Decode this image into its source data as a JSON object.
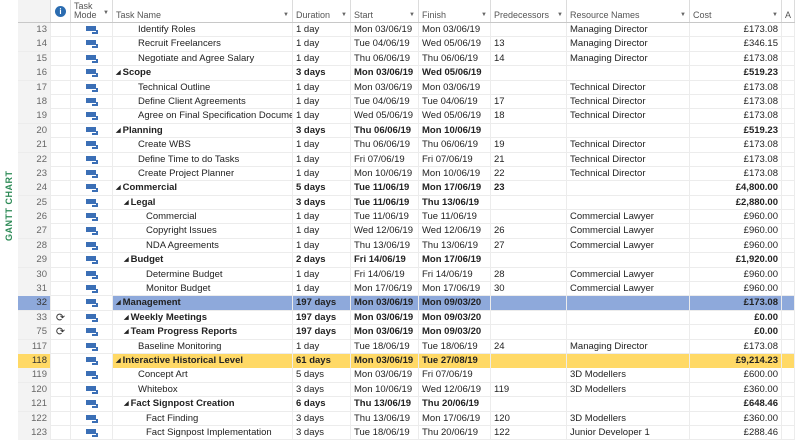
{
  "side_label": "GANTT CHART",
  "columns": {
    "indicators": "i",
    "mode": "Task Mode",
    "name": "Task Name",
    "duration": "Duration",
    "start": "Start",
    "finish": "Finish",
    "predecessors": "Predecessors",
    "resources": "Resource Names",
    "cost": "Cost",
    "extra": "A"
  },
  "rows": [
    {
      "id": "13",
      "name": "Identify Roles",
      "level": 2,
      "summary": false,
      "duration": "1 day",
      "start": "Mon 03/06/19",
      "finish": "Mon 03/06/19",
      "pred": "",
      "res": "Managing Director",
      "cost": "£173.08"
    },
    {
      "id": "14",
      "name": "Recruit Freelancers",
      "level": 2,
      "summary": false,
      "duration": "1 day",
      "start": "Tue 04/06/19",
      "finish": "Wed 05/06/19",
      "pred": "13",
      "res": "Managing Director",
      "cost": "£346.15"
    },
    {
      "id": "15",
      "name": "Negotiate and Agree Salary",
      "level": 2,
      "summary": false,
      "duration": "1 day",
      "start": "Thu 06/06/19",
      "finish": "Thu 06/06/19",
      "pred": "14",
      "res": "Managing Director",
      "cost": "£173.08"
    },
    {
      "id": "16",
      "name": "Scope",
      "level": 1,
      "summary": true,
      "duration": "3 days",
      "start": "Mon 03/06/19",
      "finish": "Wed 05/06/19",
      "pred": "",
      "res": "",
      "cost": "£519.23"
    },
    {
      "id": "17",
      "name": "Technical Outline",
      "level": 2,
      "summary": false,
      "duration": "1 day",
      "start": "Mon 03/06/19",
      "finish": "Mon 03/06/19",
      "pred": "",
      "res": "Technical Director",
      "cost": "£173.08"
    },
    {
      "id": "18",
      "name": "Define Client Agreements",
      "level": 2,
      "summary": false,
      "duration": "1 day",
      "start": "Tue 04/06/19",
      "finish": "Tue 04/06/19",
      "pred": "17",
      "res": "Technical Director",
      "cost": "£173.08"
    },
    {
      "id": "19",
      "name": "Agree on Final Specification Document",
      "level": 2,
      "summary": false,
      "duration": "1 day",
      "start": "Wed 05/06/19",
      "finish": "Wed 05/06/19",
      "pred": "18",
      "res": "Technical Director",
      "cost": "£173.08"
    },
    {
      "id": "20",
      "name": "Planning",
      "level": 1,
      "summary": true,
      "duration": "3 days",
      "start": "Thu 06/06/19",
      "finish": "Mon 10/06/19",
      "pred": "",
      "res": "",
      "cost": "£519.23"
    },
    {
      "id": "21",
      "name": "Create WBS",
      "level": 2,
      "summary": false,
      "duration": "1 day",
      "start": "Thu 06/06/19",
      "finish": "Thu 06/06/19",
      "pred": "19",
      "res": "Technical Director",
      "cost": "£173.08"
    },
    {
      "id": "22",
      "name": "Define Time to do Tasks",
      "level": 2,
      "summary": false,
      "duration": "1 day",
      "start": "Fri 07/06/19",
      "finish": "Fri 07/06/19",
      "pred": "21",
      "res": "Technical Director",
      "cost": "£173.08"
    },
    {
      "id": "23",
      "name": "Create Project Planner",
      "level": 2,
      "summary": false,
      "duration": "1 day",
      "start": "Mon 10/06/19",
      "finish": "Mon 10/06/19",
      "pred": "22",
      "res": "Technical Director",
      "cost": "£173.08"
    },
    {
      "id": "24",
      "name": "Commercial",
      "level": 1,
      "summary": true,
      "duration": "5 days",
      "start": "Tue 11/06/19",
      "finish": "Mon 17/06/19",
      "pred": "23",
      "res": "",
      "cost": "£4,800.00"
    },
    {
      "id": "25",
      "name": "Legal",
      "level": 2,
      "summary": true,
      "duration": "3 days",
      "start": "Tue 11/06/19",
      "finish": "Thu 13/06/19",
      "pred": "",
      "res": "",
      "cost": "£2,880.00"
    },
    {
      "id": "26",
      "name": "Commercial",
      "level": 3,
      "summary": false,
      "duration": "1 day",
      "start": "Tue 11/06/19",
      "finish": "Tue 11/06/19",
      "pred": "",
      "res": "Commercial Lawyer",
      "cost": "£960.00"
    },
    {
      "id": "27",
      "name": "Copyright Issues",
      "level": 3,
      "summary": false,
      "duration": "1 day",
      "start": "Wed 12/06/19",
      "finish": "Wed 12/06/19",
      "pred": "26",
      "res": "Commercial Lawyer",
      "cost": "£960.00"
    },
    {
      "id": "28",
      "name": "NDA Agreements",
      "level": 3,
      "summary": false,
      "duration": "1 day",
      "start": "Thu 13/06/19",
      "finish": "Thu 13/06/19",
      "pred": "27",
      "res": "Commercial Lawyer",
      "cost": "£960.00"
    },
    {
      "id": "29",
      "name": "Budget",
      "level": 2,
      "summary": true,
      "duration": "2 days",
      "start": "Fri 14/06/19",
      "finish": "Mon 17/06/19",
      "pred": "",
      "res": "",
      "cost": "£1,920.00"
    },
    {
      "id": "30",
      "name": "Determine Budget",
      "level": 3,
      "summary": false,
      "duration": "1 day",
      "start": "Fri 14/06/19",
      "finish": "Fri 14/06/19",
      "pred": "28",
      "res": "Commercial Lawyer",
      "cost": "£960.00"
    },
    {
      "id": "31",
      "name": "Monitor Budget",
      "level": 3,
      "summary": false,
      "duration": "1 day",
      "start": "Mon 17/06/19",
      "finish": "Mon 17/06/19",
      "pred": "30",
      "res": "Commercial Lawyer",
      "cost": "£960.00"
    },
    {
      "id": "32",
      "name": "Management",
      "level": 1,
      "summary": true,
      "duration": "197 days",
      "start": "Mon 03/06/19",
      "finish": "Mon 09/03/20",
      "pred": "",
      "res": "",
      "cost": "£173.08",
      "selected": true
    },
    {
      "id": "33",
      "name": "Weekly Meetings",
      "level": 2,
      "summary": true,
      "recurring": true,
      "duration": "197 days",
      "start": "Mon 03/06/19",
      "finish": "Mon 09/03/20",
      "pred": "",
      "res": "",
      "cost": "£0.00"
    },
    {
      "id": "75",
      "name": "Team Progress Reports",
      "level": 2,
      "summary": true,
      "recurring": true,
      "duration": "197 days",
      "start": "Mon 03/06/19",
      "finish": "Mon 09/03/20",
      "pred": "",
      "res": "",
      "cost": "£0.00"
    },
    {
      "id": "117",
      "name": "Baseline Monitoring",
      "level": 2,
      "summary": false,
      "duration": "1 day",
      "start": "Tue 18/06/19",
      "finish": "Tue 18/06/19",
      "pred": "24",
      "res": "Managing Director",
      "cost": "£173.08"
    },
    {
      "id": "118",
      "name": "Interactive Historical Level",
      "level": 1,
      "summary": true,
      "duration": "61 days",
      "start": "Mon 03/06/19",
      "finish": "Tue 27/08/19",
      "pred": "",
      "res": "",
      "cost": "£9,214.23",
      "highlight": true
    },
    {
      "id": "119",
      "name": "Concept Art",
      "level": 2,
      "summary": false,
      "duration": "5 days",
      "start": "Mon 03/06/19",
      "finish": "Fri 07/06/19",
      "pred": "",
      "res": "3D Modellers",
      "cost": "£600.00"
    },
    {
      "id": "120",
      "name": "Whitebox",
      "level": 2,
      "summary": false,
      "duration": "3 days",
      "start": "Mon 10/06/19",
      "finish": "Wed 12/06/19",
      "pred": "119",
      "res": "3D Modellers",
      "cost": "£360.00"
    },
    {
      "id": "121",
      "name": "Fact Signpost Creation",
      "level": 2,
      "summary": true,
      "duration": "6 days",
      "start": "Thu 13/06/19",
      "finish": "Thu 20/06/19",
      "pred": "",
      "res": "",
      "cost": "£648.46"
    },
    {
      "id": "122",
      "name": "Fact Finding",
      "level": 3,
      "summary": false,
      "duration": "3 days",
      "start": "Thu 13/06/19",
      "finish": "Mon 17/06/19",
      "pred": "120",
      "res": "3D Modellers",
      "cost": "£360.00"
    },
    {
      "id": "123",
      "name": "Fact Signpost Implementation",
      "level": 3,
      "summary": false,
      "duration": "3 days",
      "start": "Tue 18/06/19",
      "finish": "Thu 20/06/19",
      "pred": "122",
      "res": "Junior Developer 1",
      "cost": "£288.46"
    }
  ]
}
